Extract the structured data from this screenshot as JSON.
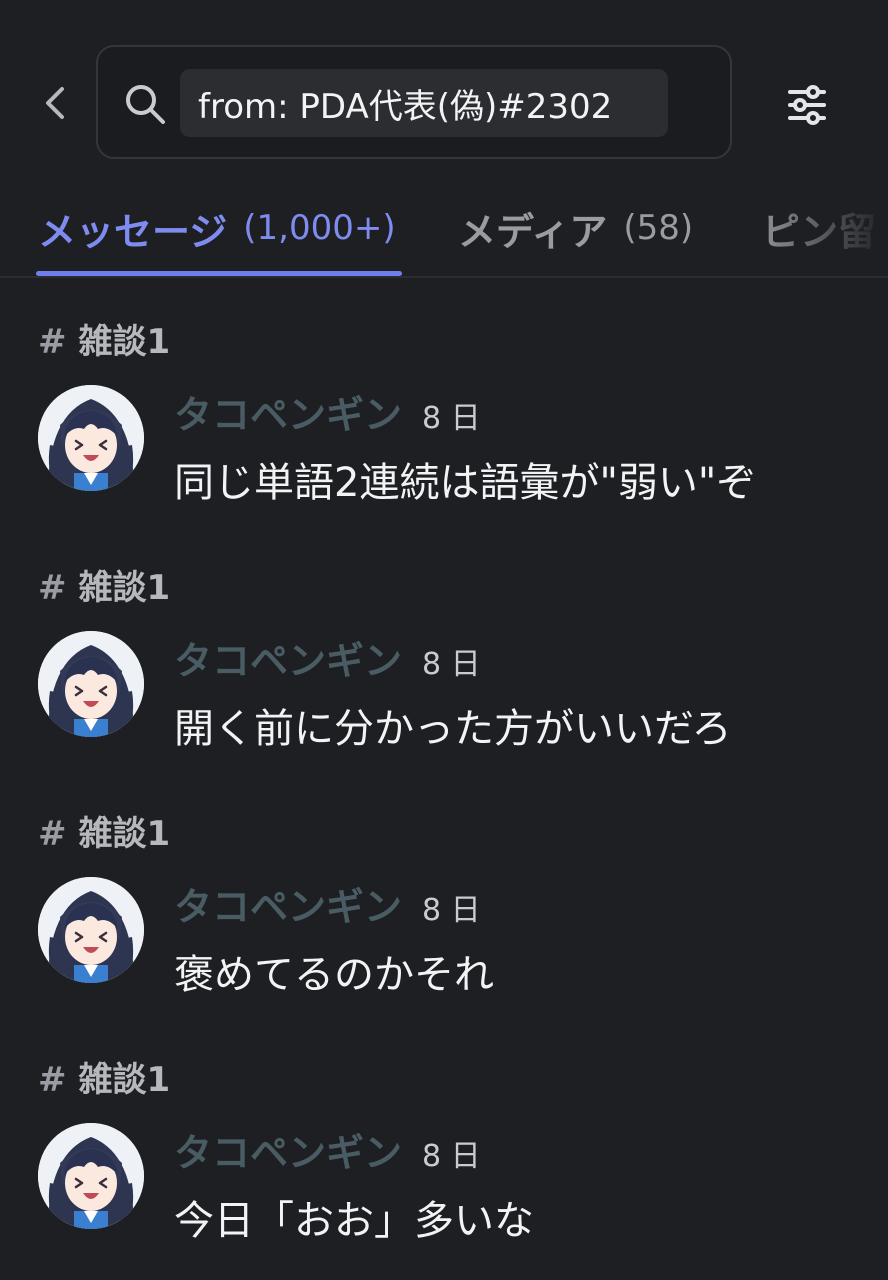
{
  "search": {
    "query": "from: PDA代表(偽)#2302"
  },
  "tabs": [
    {
      "label": "メッセージ",
      "count": "(1,000+)"
    },
    {
      "label": "メディア",
      "count": "(58)"
    },
    {
      "label": "ピン留",
      "count": ""
    }
  ],
  "results": [
    {
      "channel": "雑談1",
      "author": "タコペンギン",
      "time": "8 日",
      "message": "同じ単語2連続は語彙が\"弱い\"ぞ"
    },
    {
      "channel": "雑談1",
      "author": "タコペンギン",
      "time": "8 日",
      "message": "開く前に分かった方がいいだろ"
    },
    {
      "channel": "雑談1",
      "author": "タコペンギン",
      "time": "8 日",
      "message": "褒めてるのかそれ"
    },
    {
      "channel": "雑談1",
      "author": "タコペンギン",
      "time": "8 日",
      "message": "今日「おお」多いな"
    }
  ],
  "colors": {
    "background": "#1e1f22",
    "accent": "#7e8cf0",
    "author": "#4a5c63"
  }
}
